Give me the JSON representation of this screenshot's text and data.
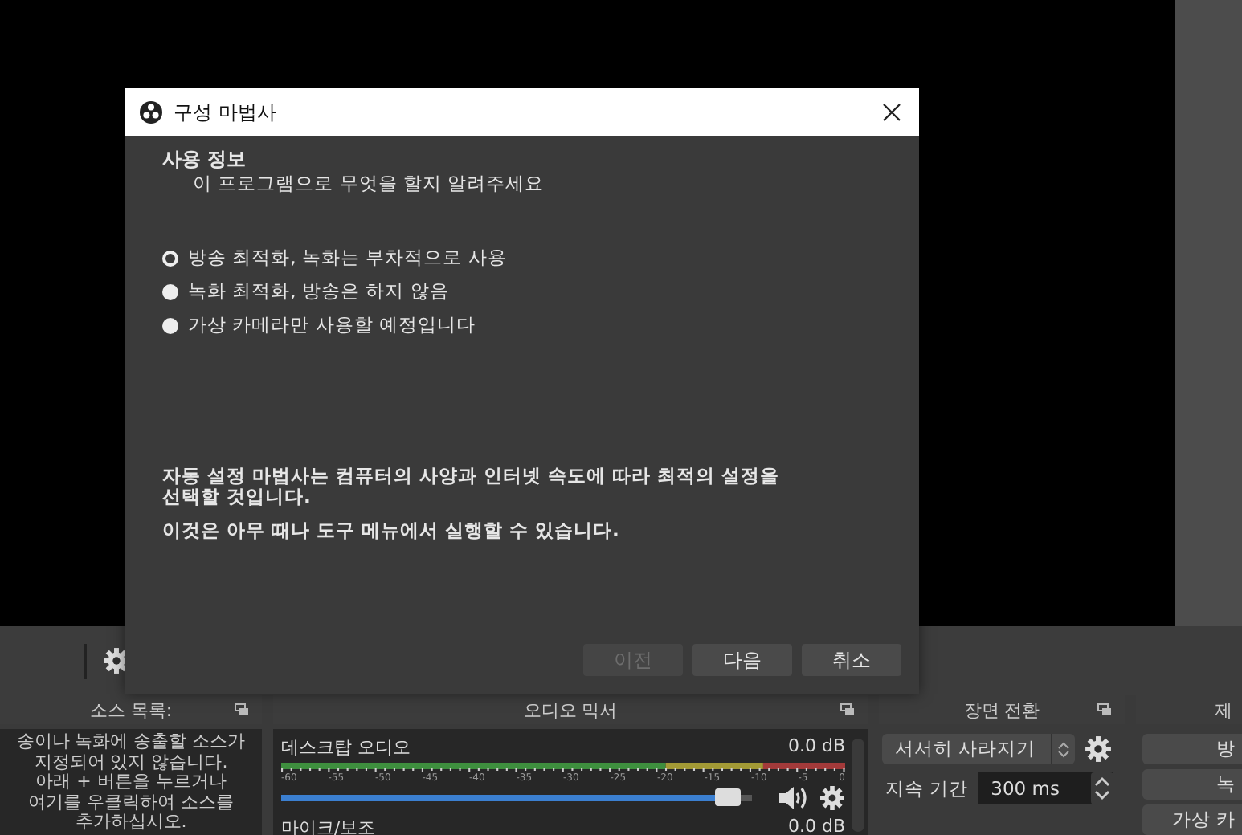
{
  "sources_dock": {
    "title": "소스 목록:",
    "empty_message": "송이나 녹화에 송출할 소스가\n지정되어 있지 않습니다.\n아래 + 버튼을 누르거나\n여기를 우클릭하여 소스를\n추가하십시오."
  },
  "audio_mixer": {
    "title": "오디오 믹서",
    "ticks": [
      "-60",
      "-55",
      "-50",
      "-45",
      "-40",
      "-35",
      "-30",
      "-25",
      "-20",
      "-15",
      "-10",
      "-5",
      "0"
    ],
    "channels": [
      {
        "name": "데스크탑 오디오",
        "reading": "0.0 dB",
        "level": 0.95
      },
      {
        "name": "마이크/보조",
        "reading": "0.0 dB"
      }
    ]
  },
  "transitions_dock": {
    "title": "장면 전환",
    "transition": "서서히 사라지기",
    "duration_label": "지속 기간",
    "duration": "300 ms"
  },
  "controls_dock": {
    "title": "제",
    "buttons": [
      "방",
      "녹",
      "가상 카"
    ]
  },
  "dialog": {
    "title": "구성 마법사",
    "heading": "사용 정보",
    "subheading": "이 프로그램으로 무엇을 할지 알려주세요",
    "options": [
      {
        "label": "방송 최적화, 녹화는 부차적으로 사용",
        "selected": true
      },
      {
        "label": "녹화 최적화, 방송은 하지 않음",
        "selected": false
      },
      {
        "label": "가상 카메라만 사용할 예정입니다",
        "selected": false
      }
    ],
    "notes": [
      "자동 설정 마법사는 컴퓨터의 사양과 인터넷 속도에 따라 최적의 설정을 선택할 것입니다.",
      "이것은 아무 때나 도구 메뉴에서 실행할 수 있습니다."
    ],
    "buttons": [
      {
        "label": "이전",
        "disabled": true
      },
      {
        "label": "다음",
        "disabled": false
      },
      {
        "label": "취소",
        "disabled": false
      }
    ]
  }
}
